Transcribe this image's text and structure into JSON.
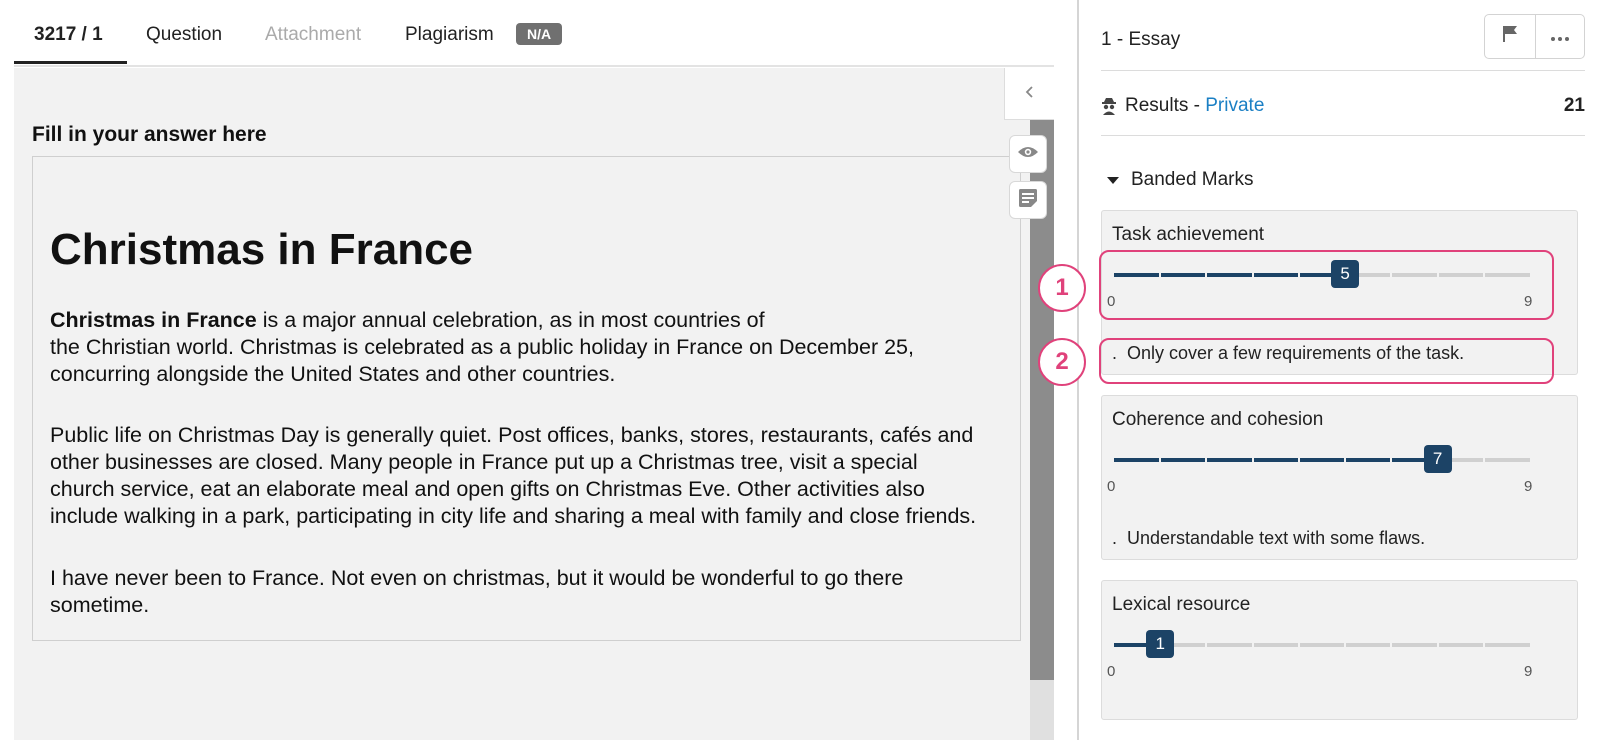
{
  "tabs": [
    {
      "label": "3217 / 1"
    },
    {
      "label": "Question"
    },
    {
      "label": "Attachment"
    },
    {
      "label": "Plagiarism",
      "badge": "N/A"
    }
  ],
  "answer": {
    "label": "Fill in your answer here",
    "title": "Christmas in France",
    "p1_bold": "Christmas in France",
    "p1_line1_rest": " is a major annual celebration, as in most countries of",
    "p1_line2": "the Christian world. Christmas is celebrated as a public holiday in France on December 25,",
    "p1_line3": "concurring alongside the United States and other countries.",
    "p2_lines": [
      "Public life on Christmas Day is generally quiet. Post offices, banks, stores, restaurants, cafés and",
      "other businesses are closed. Many people in France put up a Christmas tree, visit a special",
      "church service, eat an elaborate meal and open gifts on Christmas Eve. Other activities also",
      "include walking in a park, participating in city life and sharing a meal with family and close friends."
    ],
    "p3_lines": [
      "I have never been to France. Not even on christmas, but it would be wonderful to go there",
      "sometime."
    ]
  },
  "sidebar": {
    "essay_title": "1 - Essay",
    "results_label": "Results - ",
    "results_link": "Private",
    "results_score": "21",
    "banded_label": "Banded Marks"
  },
  "bands": [
    {
      "title": "Task achievement",
      "value": 5,
      "value_label": "5",
      "min": "0",
      "max": "9",
      "desc": "Only cover a few requirements of the task."
    },
    {
      "title": "Coherence and cohesion",
      "value": 7,
      "value_label": "7",
      "min": "0",
      "max": "9",
      "desc": "Understandable text with some flaws."
    },
    {
      "title": "Lexical resource",
      "value": 1,
      "value_label": "1",
      "min": "0",
      "max": "9",
      "desc": ""
    }
  ],
  "callouts": [
    "1",
    "2"
  ],
  "colors": {
    "accent": "#1c4366",
    "link": "#1a7fc4",
    "callout": "#e0427b",
    "badge": "#707070"
  },
  "icons": [
    "chevron-left-icon",
    "eye-icon",
    "notes-icon",
    "flag-icon",
    "more-icon",
    "spy-icon",
    "caret-down-icon"
  ]
}
